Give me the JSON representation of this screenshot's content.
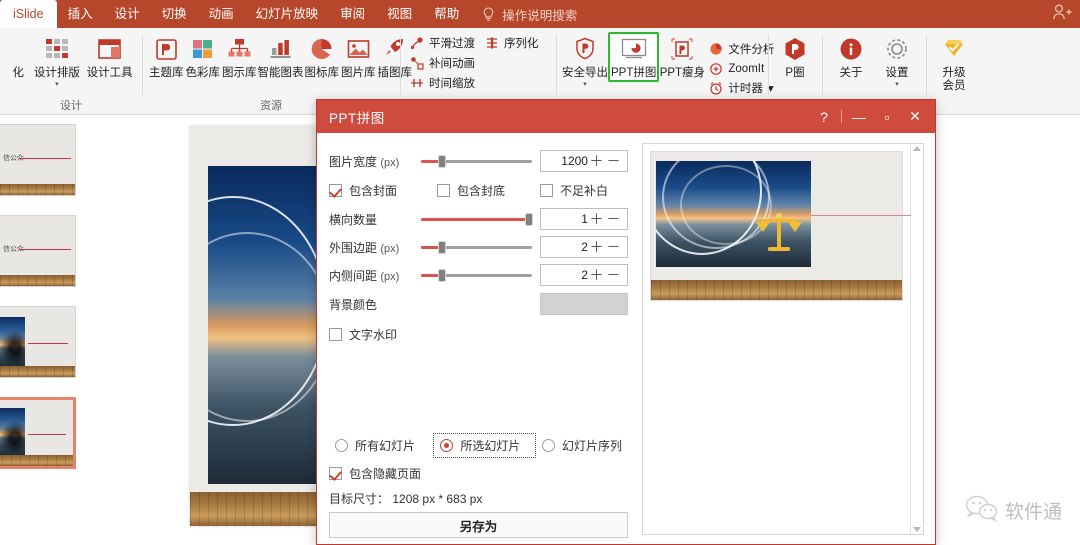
{
  "menubar": {
    "tabs": [
      {
        "label": "iSlide",
        "active": true
      },
      {
        "label": "插入",
        "active": false
      },
      {
        "label": "设计",
        "active": false
      },
      {
        "label": "切换",
        "active": false
      },
      {
        "label": "动画",
        "active": false
      },
      {
        "label": "幻灯片放映",
        "active": false
      },
      {
        "label": "审阅",
        "active": false
      },
      {
        "label": "视图",
        "active": false
      },
      {
        "label": "帮助",
        "active": false
      }
    ],
    "tell_me": "操作说明搜索",
    "tell_me_icon": "lightbulb-icon",
    "account_icon": "add-user-icon"
  },
  "ribbon": {
    "groups": [
      {
        "label": "设计",
        "buttons": [
          {
            "label": "化",
            "icon": "partial-icon",
            "caret": false
          },
          {
            "label": "设计排版",
            "icon": "grid-dots-icon",
            "caret": true
          },
          {
            "label": "设计工具",
            "icon": "window-panel-icon",
            "caret": false
          }
        ]
      },
      {
        "label": "资源",
        "buttons": [
          {
            "label": "主题库",
            "icon": "powerpoint-theme-icon",
            "caret": false
          },
          {
            "label": "色彩库",
            "icon": "color-swatches-icon",
            "caret": false
          },
          {
            "label": "图示库",
            "icon": "org-chart-icon",
            "caret": false
          },
          {
            "label": "智能图表",
            "icon": "bar-chart-icon",
            "caret": false
          },
          {
            "label": "图标库",
            "icon": "pie-slice-icon",
            "caret": false
          },
          {
            "label": "图片库",
            "icon": "picture-icon",
            "caret": false
          },
          {
            "label": "插图库",
            "icon": "rocket-icon",
            "caret": false
          }
        ]
      },
      {
        "label": "",
        "small_buttons": [
          {
            "label": "平滑过渡",
            "icon": "morph-icon"
          },
          {
            "label": "序列化",
            "icon": "sequence-icon"
          },
          {
            "label": "补间动画",
            "icon": "tween-icon"
          },
          {
            "label": "时间缩放",
            "icon": "time-scale-icon"
          }
        ]
      },
      {
        "label": "",
        "buttons": [
          {
            "label": "安全导出",
            "icon": "shield-p-icon",
            "caret": true,
            "highlight": false
          },
          {
            "label": "PPT拼图",
            "icon": "ppt-collage-icon",
            "caret": false,
            "highlight": true
          },
          {
            "label": "PPT瘦身",
            "icon": "ppt-slim-icon",
            "caret": false,
            "highlight": false
          }
        ],
        "small_buttons": [
          {
            "label": "文件分析",
            "icon": "file-analysis-icon"
          },
          {
            "label": "ZoomIt",
            "icon": "zoomit-icon"
          },
          {
            "label": "计时器",
            "icon": "timer-icon",
            "caret": true
          }
        ]
      },
      {
        "label": "",
        "buttons": [
          {
            "label": "P圈",
            "icon": "p-hexagon-icon",
            "caret": false
          }
        ]
      },
      {
        "label": "",
        "buttons": [
          {
            "label": "关于",
            "icon": "info-icon",
            "caret": false
          },
          {
            "label": "设置",
            "icon": "gear-icon",
            "caret": true
          }
        ]
      },
      {
        "label": "",
        "buttons": [
          {
            "label": "升级会员",
            "icon": "diamond-check-icon",
            "caret": false,
            "two_line": true
          }
        ]
      }
    ]
  },
  "thumbnails": [
    {
      "index": "1",
      "text": "信公众",
      "selected": false,
      "has_photo": false
    },
    {
      "index": "2",
      "text": "信公众",
      "selected": false,
      "has_photo": false
    },
    {
      "index": "3",
      "text": "",
      "selected": false,
      "has_photo": true
    },
    {
      "index": "4",
      "text": "",
      "selected": true,
      "has_photo": true
    }
  ],
  "dialog": {
    "title": "PPT拼图",
    "title_buttons": [
      {
        "name": "help-button",
        "glyph": "?"
      },
      {
        "name": "minimize-button",
        "glyph": "—"
      },
      {
        "name": "maximize-button",
        "glyph": "▫"
      },
      {
        "name": "close-button",
        "glyph": "✕"
      }
    ],
    "fields": [
      {
        "label": "图片宽度",
        "unit": "(px)",
        "value": "1200",
        "slider_pct": 19
      },
      {
        "label": "横向数量",
        "unit": "",
        "value": "1",
        "slider_pct": 97
      },
      {
        "label": "外围边距",
        "unit": "(px)",
        "value": "2",
        "slider_pct": 19
      },
      {
        "label": "内侧间距",
        "unit": "(px)",
        "value": "2",
        "slider_pct": 19
      }
    ],
    "checkboxes_row": [
      {
        "label": "包含封面",
        "checked": true
      },
      {
        "label": "包含封底",
        "checked": false
      },
      {
        "label": "不足补白",
        "checked": false
      }
    ],
    "bg_color_label": "背景颜色",
    "bg_color_value": "#d2d2d2",
    "watermark_checkbox": {
      "label": "文字水印",
      "checked": false
    },
    "scope_radios": [
      {
        "label": "所有幻灯片",
        "selected": false,
        "focused": false
      },
      {
        "label": "所选幻灯片",
        "selected": true,
        "focused": true
      },
      {
        "label": "幻灯片序列",
        "selected": false,
        "focused": false
      }
    ],
    "hidden_pages_checkbox": {
      "label": "包含隐藏页面",
      "checked": true
    },
    "target_size_label": "目标尺寸：",
    "target_size_value": "1208 px *  683 px",
    "save_button": "另存为",
    "plus_glyph": "＋",
    "minus_glyph": "－",
    "scroll_up_icon": "scroll-up-arrow-icon",
    "scroll_down_icon": "scroll-down-arrow-icon"
  },
  "watermark": {
    "text": "软件通",
    "icon": "wechat-icon"
  },
  "colors": {
    "brand_red": "#b7472a",
    "dialog_red": "#cf4b3d",
    "accent_red": "#d9534f",
    "highlight_green": "#2cbb2c",
    "selection_orange": "#e8836b"
  }
}
